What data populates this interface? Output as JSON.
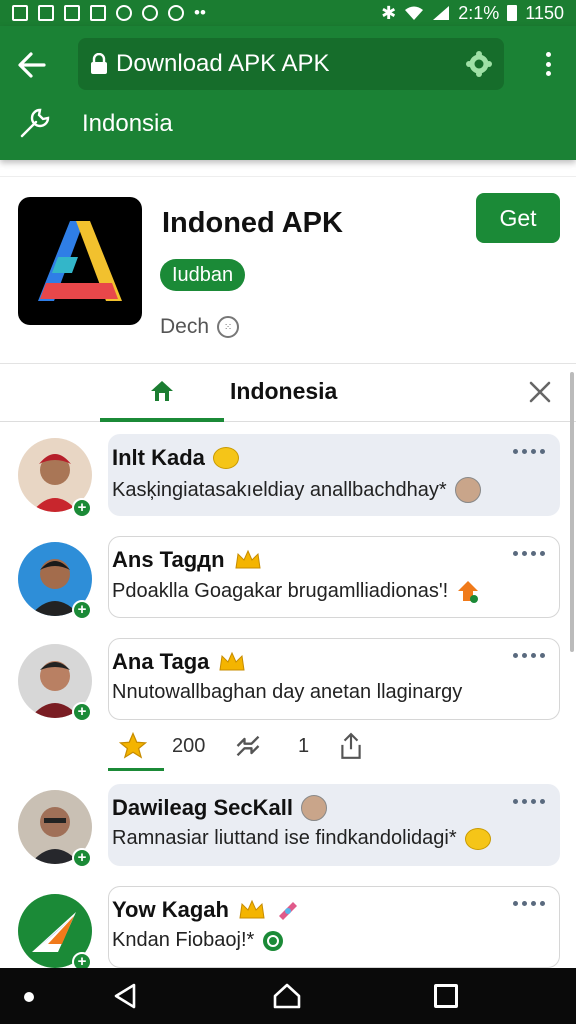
{
  "status_bar": {
    "battery": "2:1%",
    "time": "1150"
  },
  "browser": {
    "url_title": "Download APK APK",
    "tool_label": "Indonsia"
  },
  "app": {
    "name": "Indoned APK",
    "badge": "Iudban",
    "developer": "Dech",
    "get_label": "Get"
  },
  "tabs": {
    "active_label": "Indonesia"
  },
  "posts": [
    {
      "name": "Inlt Kada",
      "text": "Kasķingiatasakıeldiay anallbachdhay*"
    },
    {
      "name": "Ans Tagдn",
      "text": "Pdoaklla Goagakar brugamlliadionas'!"
    },
    {
      "name": "Ana Taga",
      "text": "Nnutowallbaghan day anetan llaginargy"
    },
    {
      "name": "Dawileag SecKall",
      "text": "Ramnasiar liuttand ise findkandolidagi*"
    },
    {
      "name": "Yow Kagah",
      "text": "Kndan Fiobaoj!*"
    }
  ],
  "actions": {
    "likes": "200",
    "reposts": "1"
  },
  "colors": {
    "brand_green": "#1b8235",
    "badge_green": "#1b8a37",
    "bubble_grey": "#eaedf3"
  }
}
